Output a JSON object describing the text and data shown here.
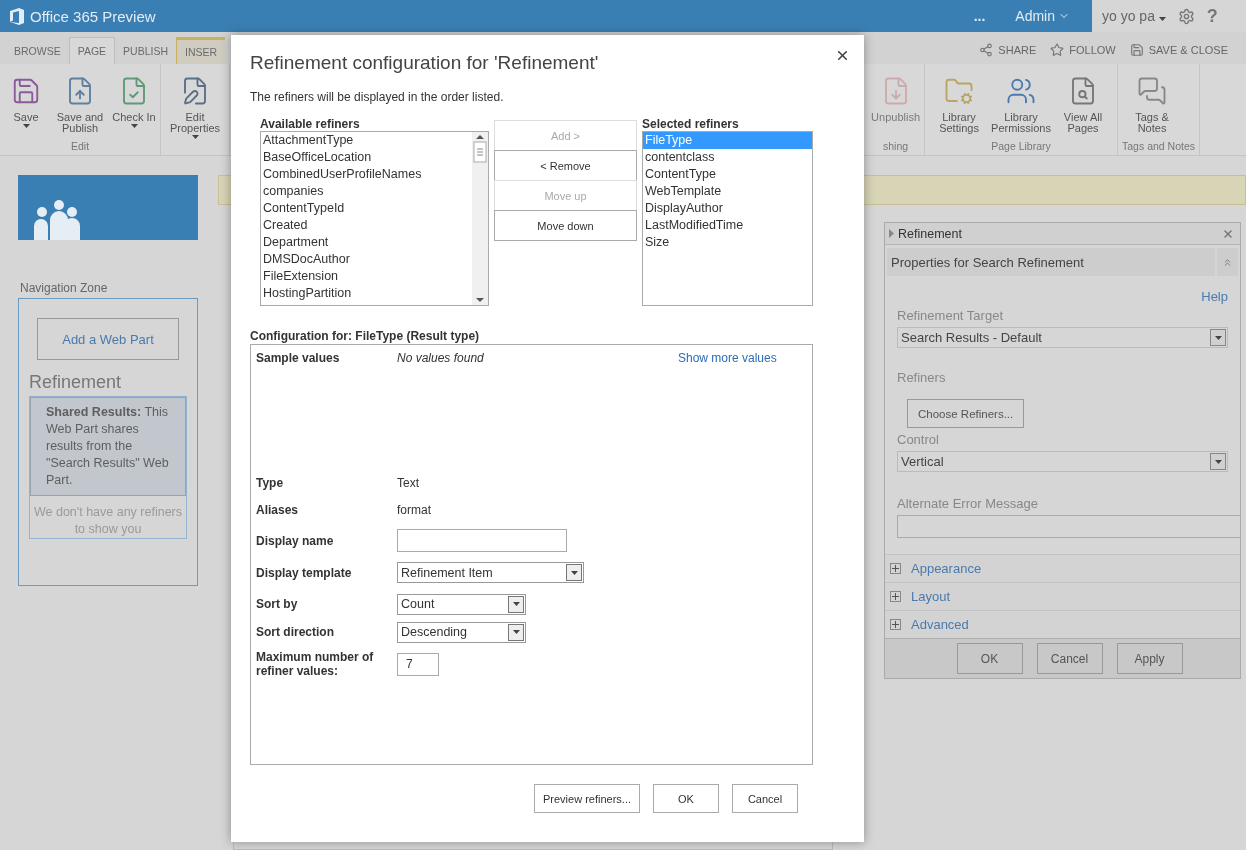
{
  "top_bar": {
    "brand": "Office 365 Preview",
    "more": "...",
    "admin": "Admin",
    "user": "yo yo pa",
    "help": "?"
  },
  "ribbon_tabs": [
    {
      "label": "BROWSE",
      "selected": false,
      "contextual": false
    },
    {
      "label": "PAGE",
      "selected": true,
      "contextual": false
    },
    {
      "label": "PUBLISH",
      "selected": false,
      "contextual": false
    },
    {
      "label": "INSER",
      "selected": false,
      "contextual": true
    }
  ],
  "page_actions": [
    {
      "kind": "share",
      "label": "SHARE"
    },
    {
      "kind": "follow",
      "label": "FOLLOW"
    },
    {
      "kind": "save",
      "label": "SAVE & CLOSE"
    }
  ],
  "ribbon_left": [
    {
      "label": "Edit",
      "buttons": [
        {
          "label": "Save",
          "kind": "save",
          "dropdown": true,
          "disabled": false
        },
        {
          "label": "Save and Publish",
          "kind": "publish",
          "dropdown": false,
          "disabled": false
        },
        {
          "label": "Check In",
          "kind": "checkin",
          "dropdown": true,
          "disabled": false
        }
      ]
    },
    {
      "buttons": [
        {
          "label": "Edit Properties",
          "kind": "properties",
          "dropdown": true,
          "disabled": false
        }
      ]
    }
  ],
  "ribbon_right": [
    {
      "label": "shing",
      "buttons": [
        {
          "label": "Unpublish",
          "kind": "unpublish",
          "dropdown": false,
          "disabled": true
        }
      ]
    },
    {
      "label": "Page Library",
      "buttons": [
        {
          "label": "Library Settings",
          "kind": "libsettings",
          "dropdown": false,
          "disabled": false
        },
        {
          "label": "Library Permissions",
          "kind": "permissions",
          "dropdown": false,
          "disabled": false
        },
        {
          "label": "View All Pages",
          "kind": "viewpages",
          "dropdown": false,
          "disabled": false
        }
      ]
    },
    {
      "label": "Tags and Notes",
      "buttons": [
        {
          "label": "Tags & Notes",
          "kind": "tags",
          "dropdown": false,
          "disabled": false
        }
      ]
    }
  ],
  "navigation_zone": {
    "title": "Navigation Zone",
    "add_button": "Add a Web Part",
    "web_part_title": "Refinement",
    "shared_note": "**Shared Results:** This Web Part shares results from the \"Search Results\" Web Part.",
    "empty_note": "We don't have any refiners to show you"
  },
  "tool_pane": {
    "title": "Refinement",
    "section": "Properties for Search Refinement",
    "help": "Help",
    "fields": [
      {
        "kind": "select",
        "label": "Refinement Target",
        "value": "Search Results - Default"
      },
      {
        "kind": "button",
        "label": "Refiners",
        "value": "Choose Refiners..."
      },
      {
        "kind": "select",
        "label": "Control",
        "value": "Vertical"
      },
      {
        "kind": "text",
        "label": "Alternate Error Message"
      }
    ],
    "sections": [
      {
        "label": "Appearance",
        "expanded": false
      },
      {
        "label": "Layout",
        "expanded": false
      },
      {
        "label": "Advanced",
        "expanded": false
      }
    ],
    "buttons": [
      "OK",
      "Cancel",
      "Apply"
    ]
  },
  "dialog": {
    "title": "Refinement configuration for 'Refinement'",
    "intro": "The refiners will be displayed in the order listed.",
    "available_label": "Available refiners",
    "available": [
      {
        "label": "AttachmentType",
        "selected": false
      },
      {
        "label": "BaseOfficeLocation",
        "selected": false
      },
      {
        "label": "CombinedUserProfileNames",
        "selected": false
      },
      {
        "label": "companies",
        "selected": false
      },
      {
        "label": "ContentTypeId",
        "selected": false
      },
      {
        "label": "Created",
        "selected": false
      },
      {
        "label": "Department",
        "selected": false
      },
      {
        "label": "DMSDocAuthor",
        "selected": false
      },
      {
        "label": "FileExtension",
        "selected": false
      },
      {
        "label": "HostingPartition",
        "selected": false
      }
    ],
    "move_buttons": [
      {
        "label": "Add >",
        "disabled": true
      },
      {
        "label": "< Remove",
        "disabled": false
      },
      {
        "label": "Move up",
        "disabled": true
      },
      {
        "label": "Move down",
        "disabled": false
      }
    ],
    "selected_label": "Selected refiners",
    "selected": [
      {
        "label": "FileType",
        "selected": true
      },
      {
        "label": "contentclass",
        "selected": false
      },
      {
        "label": "ContentType",
        "selected": false
      },
      {
        "label": "WebTemplate",
        "selected": false
      },
      {
        "label": "DisplayAuthor",
        "selected": false
      },
      {
        "label": "LastModifiedTime",
        "selected": false
      },
      {
        "label": "Size",
        "selected": false
      }
    ],
    "config_label": "Configuration for: FileType (Result type)",
    "sample": {
      "label": "Sample values",
      "value": "No values found",
      "link": "Show more values"
    },
    "rows": [
      {
        "kind": "text",
        "label": "Type",
        "value": "Text"
      },
      {
        "kind": "text",
        "label": "Aliases",
        "value": "format"
      },
      {
        "kind": "input",
        "label": "Display name"
      },
      {
        "kind": "select",
        "label": "Display template",
        "value": "Refinement Item"
      },
      {
        "kind": "select",
        "label": "Sort by",
        "value": "Count"
      },
      {
        "kind": "select",
        "label": "Sort direction",
        "value": "Descending"
      },
      {
        "kind": "input",
        "label": "Maximum number of refiner values:",
        "value": "7"
      }
    ],
    "buttons": [
      "Preview refiners...",
      "OK",
      "Cancel"
    ]
  }
}
